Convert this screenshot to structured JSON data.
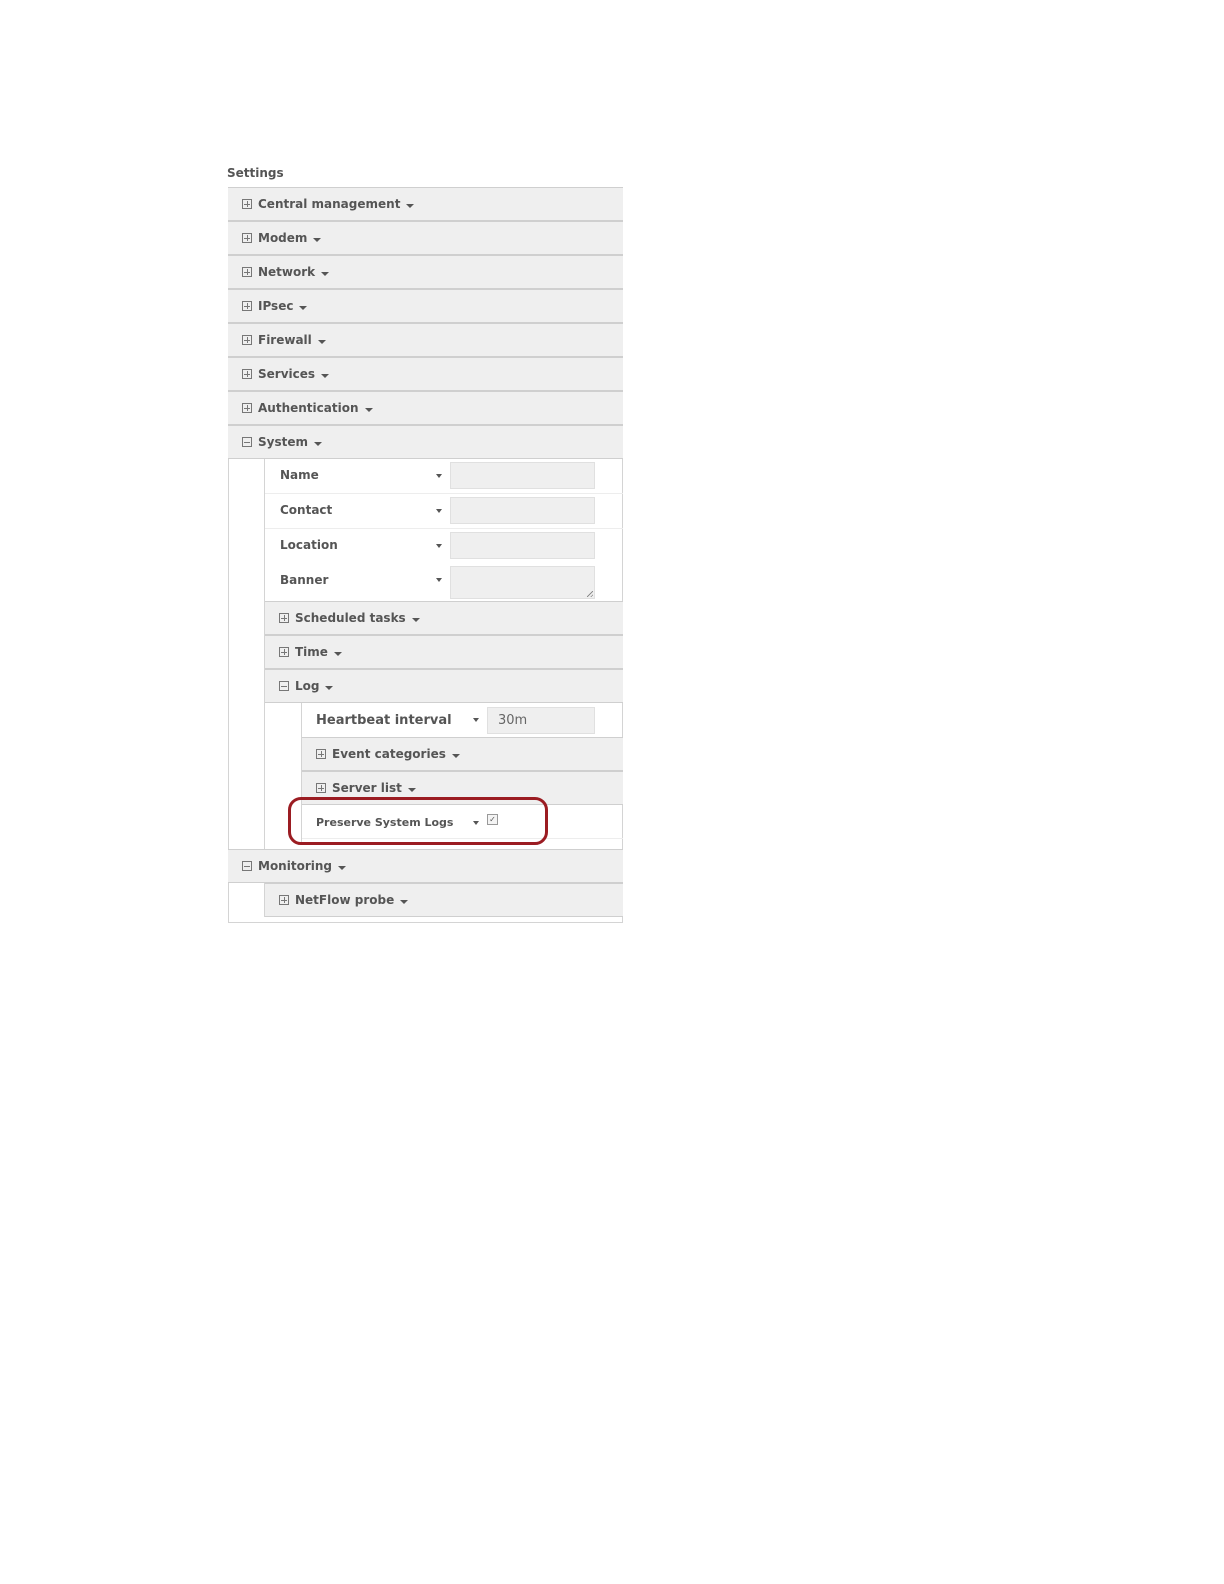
{
  "settings_title": "Settings",
  "groups": {
    "central_management": "Central management",
    "modem": "Modem",
    "network": "Network",
    "ipsec": "IPsec",
    "firewall": "Firewall",
    "services": "Services",
    "authentication": "Authentication",
    "system": "System",
    "monitoring": "Monitoring"
  },
  "system": {
    "fields": {
      "name": {
        "label": "Name",
        "value": ""
      },
      "contact": {
        "label": "Contact",
        "value": ""
      },
      "location": {
        "label": "Location",
        "value": ""
      },
      "banner": {
        "label": "Banner",
        "value": ""
      }
    },
    "scheduled_tasks": "Scheduled tasks",
    "time": "Time",
    "log": "Log"
  },
  "log": {
    "heartbeat_interval": {
      "label": "Heartbeat interval",
      "value": "30m"
    },
    "event_categories": "Event categories",
    "server_list": "Server list",
    "preserve_system_logs": {
      "label": "Preserve System Logs",
      "checked": true
    }
  },
  "monitoring": {
    "netflow_probe": "NetFlow probe"
  },
  "icons": {
    "expanded": "minus-box-icon",
    "collapsed": "plus-box-icon",
    "dropdown": "caret-down-icon"
  },
  "colors": {
    "group_background": "#efefef",
    "input_background": "#efefef",
    "highlight_outline": "#9b1c22"
  }
}
